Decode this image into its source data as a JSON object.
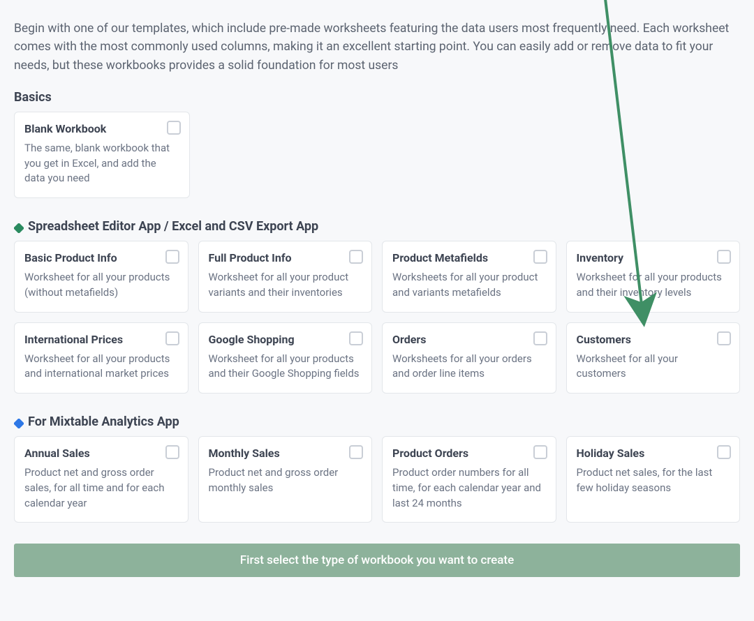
{
  "intro": "Begin with one of our templates, which include pre-made worksheets featuring the data users most frequently need. Each worksheet comes with the most commonly used columns, making it an excellent starting point. You can easily add or remove data to fit your needs, but these workbooks provides a solid foundation for most users",
  "sections": {
    "basics": {
      "heading": "Basics",
      "cards": [
        {
          "title": "Blank Workbook",
          "desc": "The same, blank workbook that you get in Excel, and add the data you need"
        }
      ]
    },
    "editor": {
      "heading": "Spreadsheet Editor App / Excel and CSV Export App",
      "cards": [
        {
          "title": "Basic Product Info",
          "desc": "Worksheet for all your products (without metafields)"
        },
        {
          "title": "Full Product Info",
          "desc": "Worksheet for all your product variants and their inventories"
        },
        {
          "title": "Product Metafields",
          "desc": "Worksheets for all your product and variants metafields"
        },
        {
          "title": "Inventory",
          "desc": "Worksheet for all your products and their inventory levels"
        },
        {
          "title": "International Prices",
          "desc": "Worksheet for all your products and international market prices"
        },
        {
          "title": "Google Shopping",
          "desc": "Worksheet for all your products and their Google Shopping fields"
        },
        {
          "title": "Orders",
          "desc": "Worksheets for all your orders and order line items"
        },
        {
          "title": "Customers",
          "desc": "Worksheet for all your customers"
        }
      ]
    },
    "analytics": {
      "heading": "For Mixtable Analytics App",
      "cards": [
        {
          "title": "Annual Sales",
          "desc": "Product net and gross order sales, for all time and for each calendar year"
        },
        {
          "title": "Monthly Sales",
          "desc": "Product net and gross order monthly sales"
        },
        {
          "title": "Product Orders",
          "desc": "Product order numbers for all time, for each calendar year and last 24 months"
        },
        {
          "title": "Holiday Sales",
          "desc": "Product net sales, for the last few holiday seasons"
        }
      ]
    }
  },
  "footer": "First select the type of workbook you want to create",
  "arrow": {
    "color": "#3f8f65"
  }
}
